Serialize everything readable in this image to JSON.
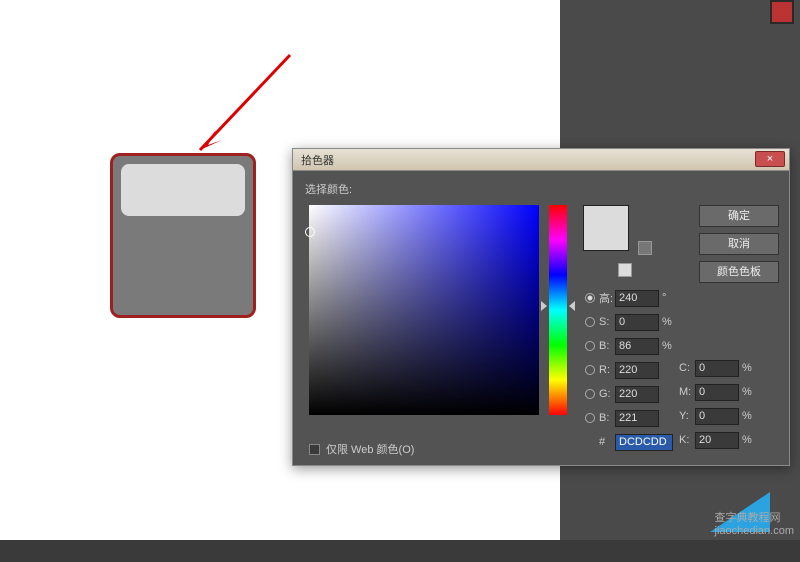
{
  "dialog": {
    "title": "拾色器",
    "select_label": "选择颜色:",
    "buttons": {
      "ok": "确定",
      "cancel": "取消",
      "swatches": "颜色色板"
    },
    "close": "×",
    "web_only": "仅限 Web 颜色(O)",
    "hsb": {
      "h_label": "高:",
      "h_val": "240",
      "h_unit": "°",
      "s_label": "S:",
      "s_val": "0",
      "s_unit": "%",
      "b_label": "B:",
      "b_val": "86",
      "b_unit": "%"
    },
    "rgb": {
      "r_label": "R:",
      "r_val": "220",
      "g_label": "G:",
      "g_val": "220",
      "b_label": "B:",
      "b_val": "221"
    },
    "cmyk": {
      "c_label": "C:",
      "c_val": "0",
      "c_unit": "%",
      "m_label": "M:",
      "m_val": "0",
      "m_unit": "%",
      "y_label": "Y:",
      "y_val": "0",
      "y_unit": "%",
      "k_label": "K:",
      "k_val": "20",
      "k_unit": "%"
    },
    "hex": {
      "label": "#",
      "val": "DCDCDD"
    },
    "swatch": {
      "new": "#DCDCDD",
      "old": "#DCDCDD"
    }
  },
  "watermark": {
    "line1": "查字典教程网",
    "line2": "jiaochedian.com"
  }
}
